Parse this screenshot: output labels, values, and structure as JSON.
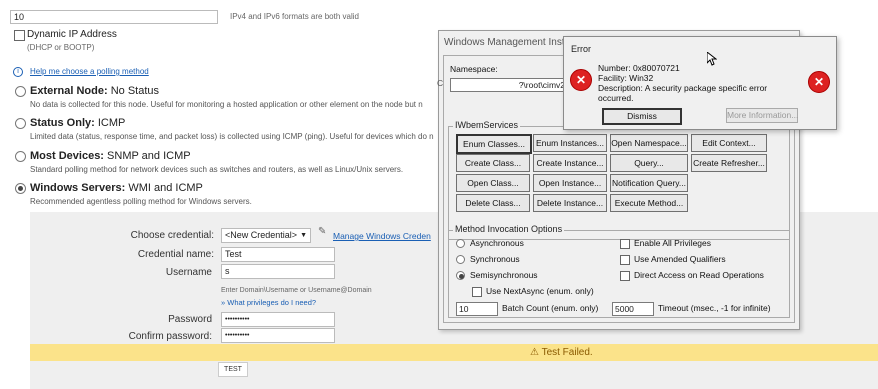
{
  "top": {
    "ip_value": "10",
    "ip_hint": "IPv4 and IPv6 formats are both valid",
    "dynamic_ip_label": "Dynamic IP Address",
    "dynamic_ip_sub": "(DHCP or BOOTP)",
    "help_link": "Help me choose a polling method"
  },
  "polling": [
    {
      "title": "External Node:",
      "title_rest": " No Status",
      "desc": "No data is collected for this node. Useful for monitoring a hosted application or other element on the node but n"
    },
    {
      "title": "Status Only:",
      "title_rest": " ICMP",
      "desc": "Limited data (status, response time, and packet loss) is collected using ICMP (ping). Useful for devices which do n"
    },
    {
      "title": "Most Devices:",
      "title_rest": " SNMP and ICMP",
      "desc": "Standard polling method for network devices such as switches and routers, as well as Linux/Unix servers."
    },
    {
      "title": "Windows Servers:",
      "title_rest": " WMI and ICMP",
      "desc": "Recommended agentless polling method for Windows servers."
    }
  ],
  "cred": {
    "choose_label": "Choose credential:",
    "choose_value": "<New Credential>",
    "manage_link": "Manage Windows Creden",
    "name_label": "Credential name:",
    "name_value": "Test",
    "user_label": "Username",
    "user_value": "s",
    "user_hint": "Enter Domain\\Username or Username@Domain",
    "privileges_link": "» What privileges do I need?",
    "password_label": "Password",
    "password_value": "••••••••••",
    "confirm_label": "Confirm password:",
    "confirm_value": "••••••••••",
    "banner": "⚠ Test Failed.",
    "test_button": "TEST"
  },
  "wmi": {
    "title": "Windows Management Instru",
    "namespace_label": "Namespace:",
    "namespace_value": "?\\root\\cimv2",
    "connect_label": "C",
    "services_group": "IWbemServices",
    "buttons": [
      [
        "Enum Classes...",
        "Enum Instances...",
        "Open Namespace...",
        "Edit Context..."
      ],
      [
        "Create Class...",
        "Create Instance...",
        "Query...",
        "Create Refresher..."
      ],
      [
        "Open Class...",
        "Open Instance...",
        "Notification Query..."
      ],
      [
        "Delete Class...",
        "Delete Instance...",
        "Execute Method..."
      ]
    ],
    "invocation_group": "Method Invocation Options",
    "asynchronous": "Asynchronous",
    "synchronous": "Synchronous",
    "semisynchronous": "Semisynchronous",
    "use_nextasync": "Use NextAsync (enum. only)",
    "enable_privileges": "Enable All Privileges",
    "use_amended": "Use Amended Qualifiers",
    "direct_access": "Direct Access on Read Operations",
    "batch_value": "10",
    "batch_label": "Batch Count (enum. only)",
    "timeout_value": "5000",
    "timeout_label": "Timeout (msec., -1 for infinite)"
  },
  "error": {
    "title": "Error",
    "number": "Number: 0x80070721",
    "facility": "Facility: Win32",
    "description": "Description: A security package specific error",
    "description2": "occurred.",
    "dismiss": "Dismiss",
    "more_info": "More Information..."
  },
  "colors": {
    "banner": "#fbe38a",
    "error_icon": "#d22",
    "link": "#1a5fb4"
  }
}
